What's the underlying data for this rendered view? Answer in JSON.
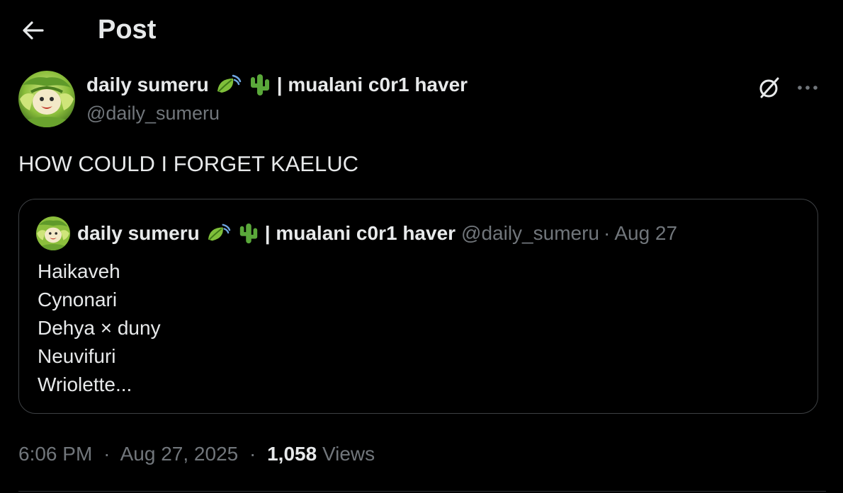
{
  "header": {
    "title": "Post",
    "back_icon": "arrow-left-icon"
  },
  "post": {
    "author": {
      "name": "daily sumeru",
      "name_suffix": "| mualani c0r1 haver",
      "emojis": [
        "leaf-wind-emoji",
        "cactus-emoji"
      ],
      "handle": "@daily_sumeru"
    },
    "actions": {
      "grok_icon": "grok-icon",
      "more_icon": "more-dots-icon"
    },
    "text": "HOW COULD I FORGET KAELUC",
    "quote": {
      "author_name": "daily sumeru",
      "name_suffix": "| mualani c0r1 haver",
      "handle": "@daily_sumeru",
      "separator": "·",
      "date": "Aug 27",
      "lines": [
        "Haikaveh",
        "Cynonari",
        "Dehya × duny",
        "Neuvifuri",
        "Wriolette..."
      ]
    },
    "meta": {
      "time": "6:06 PM",
      "separator": "·",
      "date": "Aug 27, 2025",
      "views_count": "1,058",
      "views_label": "Views"
    }
  },
  "colors": {
    "background": "#000000",
    "primary_text": "#e7e9ea",
    "secondary_text": "#71767b",
    "border": "#3e4144"
  }
}
